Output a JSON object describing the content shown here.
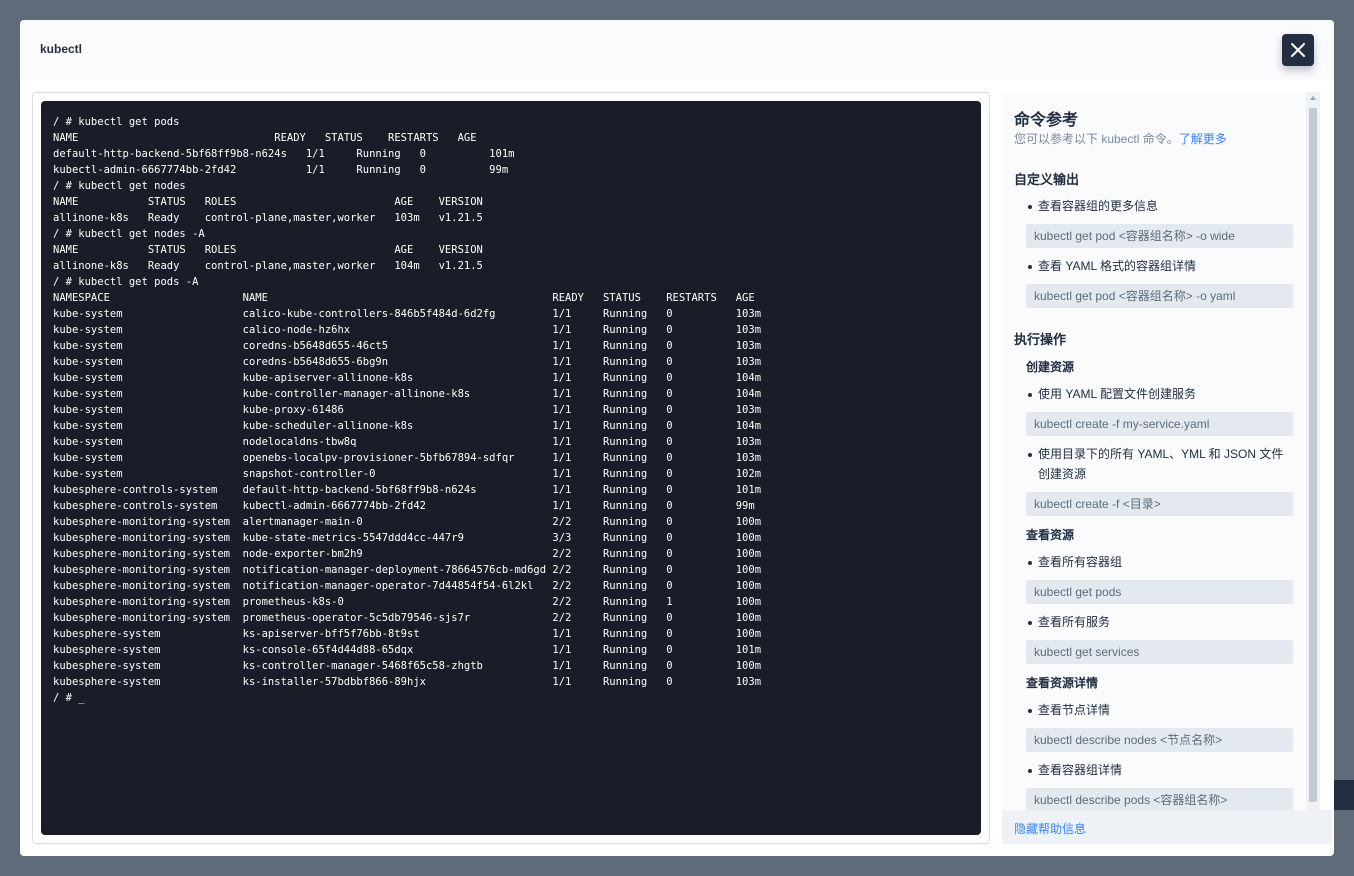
{
  "modal": {
    "title": "kubectl",
    "close_icon": "close-icon"
  },
  "terminal": {
    "lines": [
      "/ # kubectl get pods",
      "NAME                               READY   STATUS    RESTARTS   AGE",
      "default-http-backend-5bf68ff9b8-n624s   1/1     Running   0          101m",
      "kubectl-admin-6667774bb-2fd42           1/1     Running   0          99m",
      "/ # kubectl get nodes",
      "NAME           STATUS   ROLES                         AGE    VERSION",
      "allinone-k8s   Ready    control-plane,master,worker   103m   v1.21.5",
      "/ # kubectl get nodes -A",
      "NAME           STATUS   ROLES                         AGE    VERSION",
      "allinone-k8s   Ready    control-plane,master,worker   104m   v1.21.5",
      "/ # kubectl get pods -A",
      "NAMESPACE                     NAME                                             READY   STATUS    RESTARTS   AGE",
      "kube-system                   calico-kube-controllers-846b5f484d-6d2fg         1/1     Running   0          103m",
      "kube-system                   calico-node-hz6hx                                1/1     Running   0          103m",
      "kube-system                   coredns-b5648d655-46ct5                          1/1     Running   0          103m",
      "kube-system                   coredns-b5648d655-6bg9n                          1/1     Running   0          103m",
      "kube-system                   kube-apiserver-allinone-k8s                      1/1     Running   0          104m",
      "kube-system                   kube-controller-manager-allinone-k8s             1/1     Running   0          104m",
      "kube-system                   kube-proxy-61486                                 1/1     Running   0          103m",
      "kube-system                   kube-scheduler-allinone-k8s                      1/1     Running   0          104m",
      "kube-system                   nodelocaldns-tbw8q                               1/1     Running   0          103m",
      "kube-system                   openebs-localpv-provisioner-5bfb67894-sdfqr      1/1     Running   0          103m",
      "kube-system                   snapshot-controller-0                            1/1     Running   0          102m",
      "kubesphere-controls-system    default-http-backend-5bf68ff9b8-n624s            1/1     Running   0          101m",
      "kubesphere-controls-system    kubectl-admin-6667774bb-2fd42                    1/1     Running   0          99m",
      "kubesphere-monitoring-system  alertmanager-main-0                              2/2     Running   0          100m",
      "kubesphere-monitoring-system  kube-state-metrics-5547ddd4cc-447r9              3/3     Running   0          100m",
      "kubesphere-monitoring-system  node-exporter-bm2h9                              2/2     Running   0          100m",
      "kubesphere-monitoring-system  notification-manager-deployment-78664576cb-md6gd 2/2     Running   0          100m",
      "kubesphere-monitoring-system  notification-manager-operator-7d44854f54-6l2kl   2/2     Running   0          100m",
      "kubesphere-monitoring-system  prometheus-k8s-0                                 2/2     Running   1          100m",
      "kubesphere-monitoring-system  prometheus-operator-5c5db79546-sjs7r             2/2     Running   0          100m",
      "kubesphere-system             ks-apiserver-bff5f76bb-8t9st                     1/1     Running   0          100m",
      "kubesphere-system             ks-console-65f4d44d88-65dqx                      1/1     Running   0          101m",
      "kubesphere-system             ks-controller-manager-5468f65c58-zhgtb           1/1     Running   0          100m",
      "kubesphere-system             ks-installer-57bdbbf866-89hjx                    1/1     Running   0          103m",
      "/ # _"
    ]
  },
  "help": {
    "title": "命令参考",
    "desc": "您可以参考以下 kubectl 命令。",
    "learn_more": "了解更多",
    "custom_output": {
      "title": "自定义输出",
      "items": [
        {
          "text": "查看容器组的更多信息",
          "cmd": "kubectl get pod <容器组名称> -o wide"
        },
        {
          "text": "查看 YAML 格式的容器组详情",
          "cmd": "kubectl get pod <容器组名称> -o yaml"
        }
      ]
    },
    "operations": {
      "title": "执行操作",
      "create": {
        "title": "创建资源",
        "items": [
          {
            "text": "使用 YAML 配置文件创建服务",
            "cmd": "kubectl create -f my-service.yaml"
          },
          {
            "text": "使用目录下的所有 YAML、YML 和 JSON 文件创建资源",
            "cmd": "kubectl create -f <目录>"
          }
        ]
      },
      "view": {
        "title": "查看资源",
        "items": [
          {
            "text": "查看所有容器组",
            "cmd": "kubectl get pods"
          },
          {
            "text": "查看所有服务",
            "cmd": "kubectl get services"
          }
        ]
      },
      "detail": {
        "title": "查看资源详情",
        "items": [
          {
            "text": "查看节点详情",
            "cmd": "kubectl describe nodes <节点名称>"
          },
          {
            "text": "查看容器组详情",
            "cmd": "kubectl describe pods <容器组名称>"
          }
        ]
      }
    },
    "hide_label": "隐藏帮助信息"
  },
  "colors": {
    "terminal_bg": "#181d28",
    "link": "#3385ff",
    "header_dark": "#242e42"
  }
}
